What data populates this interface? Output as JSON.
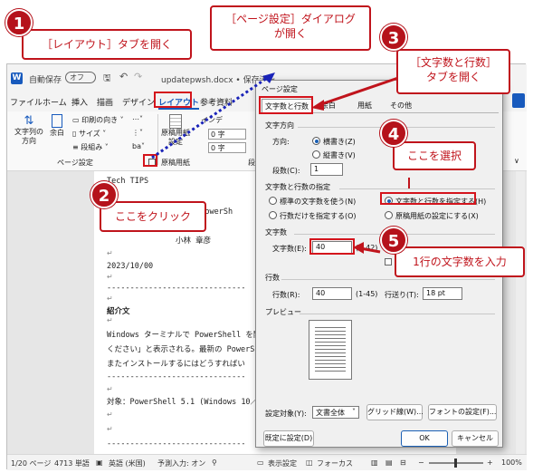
{
  "window": {
    "autosave": "自動保存",
    "autosave_state": "オフ",
    "filename": "updatepwsh.docx • 保存済み",
    "collapse_glyph": "∨"
  },
  "menu": [
    "ファイル",
    "ホーム",
    "挿入",
    "描画",
    "デザイン",
    "レイアウト",
    "参考資料"
  ],
  "ribbon": {
    "text_direction": "文字列の\n方向",
    "margins": "余白",
    "orientation": "印刷の向き",
    "size": "サイズ",
    "columns": "段組み",
    "page_setup_group": "ページ設定",
    "genko": "原稿用紙\n設定",
    "genko_group": "原稿用紙",
    "indent_label": "インデ",
    "indent_left": "0 字",
    "indent_right": "0 字",
    "para_group": "段"
  },
  "document": {
    "lines": [
      "Tech TIPS",
      "「 と PowerSh",
      "小林 章彦",
      "2023/10/00",
      "------------------------------",
      "紹介文",
      "Windows ターミナルで PowerShell を開く",
      "ください」と表示される。最新の PowerShe",
      "またインストールするにはどうすればい",
      "------------------------------",
      "対象：PowerShell 5.1 (Windows 10／11)",
      "------------------------------"
    ]
  },
  "status": {
    "page": "1/20 ページ",
    "words": "4713 単語",
    "language": "英語 (米国)",
    "predict": "予測入力: オン",
    "display": "表示設定",
    "focus": "フォーカス",
    "zoom": "100%"
  },
  "dialog": {
    "title": "ページ設定",
    "tabs": [
      "文字数と行数",
      "余白",
      "用紙",
      "その他"
    ],
    "direction_group": "文字方向",
    "direction_label": "方向:",
    "direction_horizontal": "横書き(Z)",
    "direction_vertical": "縦書き(V)",
    "columns_label": "段数(C):",
    "columns_value": "1",
    "grid_group": "文字数と行数の指定",
    "grid_options": [
      "標準の文字数を使う(N)",
      "文字数と行数を指定する(H)",
      "行数だけを指定する(O)",
      "原稿用紙の設定にする(X)"
    ],
    "chars_group": "文字数",
    "chars_label": "文字数(E):",
    "chars_value": "40",
    "chars_range": "(1-42)",
    "lines_group": "行数",
    "lines_label": "行数(R):",
    "lines_value": "40",
    "lines_range": "(1-45)",
    "pitch_label": "行送り(T):",
    "pitch_value": "18 pt",
    "preview_group": "プレビュー",
    "apply_label": "設定対象(Y):",
    "apply_value": "文書全体",
    "grid_button": "グリッド線(W)...",
    "font_button": "フォントの設定(F)...",
    "default_button": "既定に設定(D)",
    "ok_button": "OK",
    "cancel_button": "キャンセル"
  },
  "callouts": {
    "c1": "［レイアウト］タブを開く",
    "c2": "ここをクリック",
    "c3_line1": "［ページ設定］ダイアログ",
    "c3_line2": "が開く",
    "c4_line1": "［文字数と行数］",
    "c4_line2": "タブを開く",
    "c5": "ここを選択",
    "c6": "1行の文字数を入力",
    "n1": "1",
    "n2": "2",
    "n3": "3",
    "n4": "4",
    "n5": "5"
  },
  "colors": {
    "accent": "#c0141c",
    "dotted_arrow": "#1a23b8",
    "word_blue": "#185abd"
  }
}
